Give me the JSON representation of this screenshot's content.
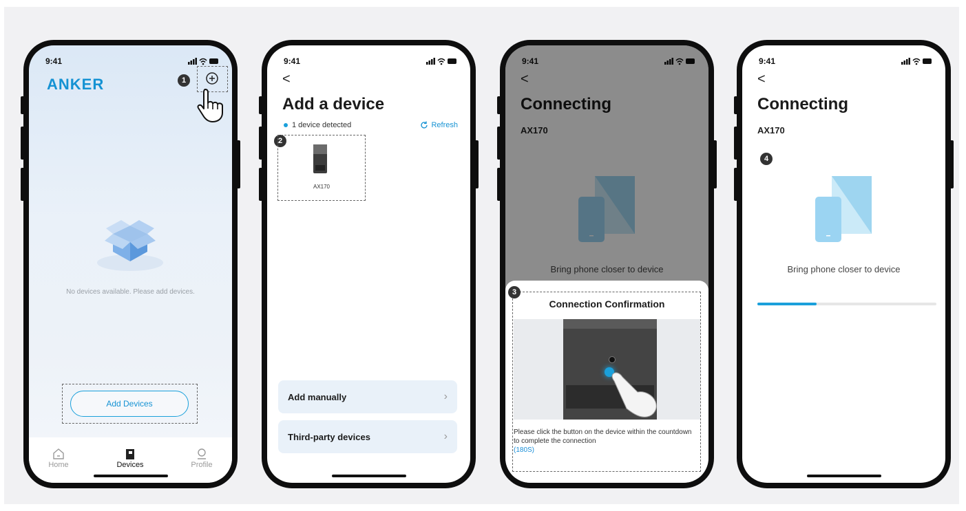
{
  "status": {
    "time": "9:41"
  },
  "phone1": {
    "logo": "ANKER",
    "step": "1",
    "empty_text": "No devices available. Please add devices.",
    "add_button": "Add Devices",
    "tabs": [
      {
        "label": "Home",
        "icon": "home-icon",
        "active": false
      },
      {
        "label": "Devices",
        "icon": "devices-icon",
        "active": true
      },
      {
        "label": "Profile",
        "icon": "profile-icon",
        "active": false
      }
    ]
  },
  "phone2": {
    "back": "<",
    "title": "Add a device",
    "detected": "1 device detected",
    "refresh": "Refresh",
    "step": "2",
    "device_name": "AX170",
    "menu": [
      {
        "label": "Add manually"
      },
      {
        "label": "Third-party devices"
      }
    ]
  },
  "phone3": {
    "back": "<",
    "title": "Connecting",
    "subtitle": "AX170",
    "hint": "Bring phone closer to device",
    "step": "3",
    "sheet_title": "Connection Confirmation",
    "sheet_text": "Please click the button on the device within the countdown to complete the connection",
    "countdown": "(180S)"
  },
  "phone4": {
    "back": "<",
    "title": "Connecting",
    "subtitle": "AX170",
    "hint": "Bring phone closer to device",
    "step": "4",
    "progress": 0.33
  },
  "colors": {
    "accent": "#1592d3",
    "accent_light": "#1aa0db"
  }
}
